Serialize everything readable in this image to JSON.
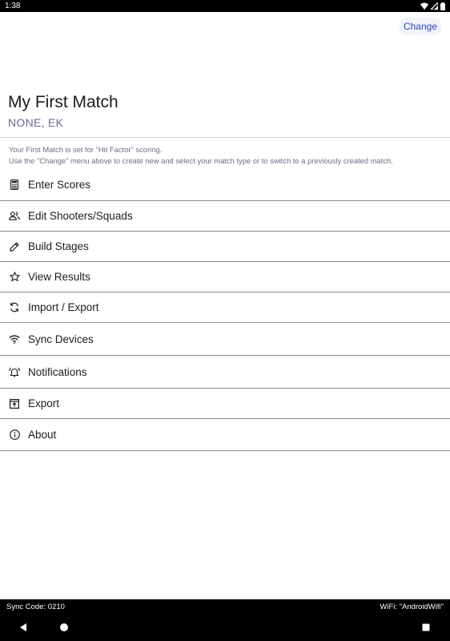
{
  "status_bar": {
    "time": "1:38"
  },
  "app_bar": {
    "change_label": "Change"
  },
  "match": {
    "title": "My First Match",
    "subtitle": "NONE, EK"
  },
  "info": {
    "line1": "Your First Match is set for \"Hit Factor\" scoring.",
    "line2": "Use the \"Change\" menu above to create new and select your match type or to switch to a previously created match."
  },
  "menu": [
    {
      "label": "Enter Scores",
      "icon": "calculator-icon"
    },
    {
      "label": "Edit Shooters/Squads",
      "icon": "people-icon"
    },
    {
      "label": "Build Stages",
      "icon": "pencil-icon"
    },
    {
      "label": "View Results",
      "icon": "star-icon"
    },
    {
      "label": "Import / Export",
      "icon": "sync-icon"
    },
    {
      "label": "Sync Devices",
      "icon": "wifi-icon"
    },
    {
      "label": "Notifications",
      "icon": "bell-icon"
    },
    {
      "label": "Export",
      "icon": "archive-icon"
    },
    {
      "label": "About",
      "icon": "info-icon"
    }
  ],
  "footer": {
    "sync_code": "Sync Code: 0210",
    "wifi": "WiFi: \"AndroidWifi\""
  }
}
